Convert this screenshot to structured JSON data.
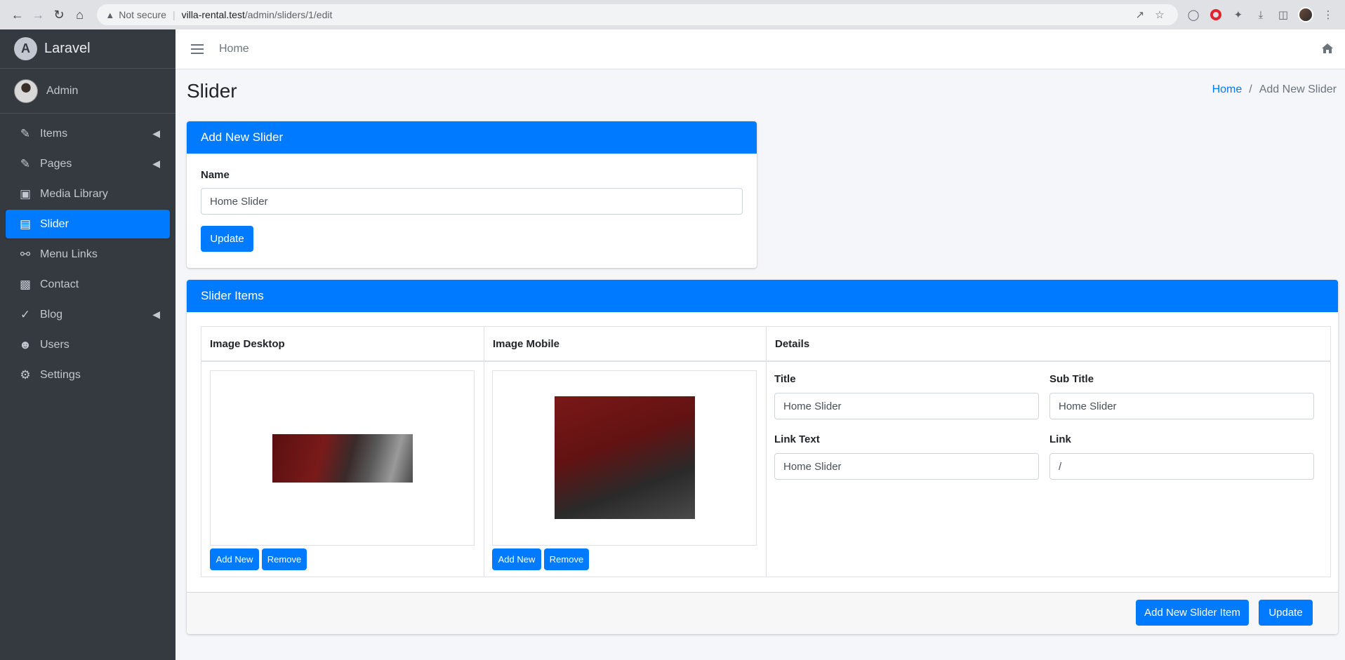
{
  "browser": {
    "security": "Not secure",
    "url_host": "villa-rental.test",
    "url_path": "/admin/sliders/1/edit"
  },
  "sidebar": {
    "brand": "Laravel",
    "user": "Admin",
    "items": [
      {
        "label": "Items",
        "icon": "edit-icon",
        "has_children": true
      },
      {
        "label": "Pages",
        "icon": "edit-icon",
        "has_children": true
      },
      {
        "label": "Media Library",
        "icon": "photo-video-icon",
        "has_children": false
      },
      {
        "label": "Slider",
        "icon": "images-icon",
        "has_children": false,
        "active": true
      },
      {
        "label": "Menu Links",
        "icon": "link-icon",
        "has_children": false
      },
      {
        "label": "Contact",
        "icon": "address-book-icon",
        "has_children": false
      },
      {
        "label": "Blog",
        "icon": "blog-icon",
        "has_children": true
      },
      {
        "label": "Users",
        "icon": "users-icon",
        "has_children": false
      },
      {
        "label": "Settings",
        "icon": "cogs-icon",
        "has_children": false
      }
    ]
  },
  "header": {
    "home_link": "Home"
  },
  "page": {
    "title": "Slider",
    "breadcrumb": [
      "Home",
      "Add New Slider"
    ]
  },
  "slider_form": {
    "header": "Add New Slider",
    "name_label": "Name",
    "name_value": "Home Slider",
    "update_label": "Update"
  },
  "slider_items": {
    "header": "Slider Items",
    "columns": [
      "Image Desktop",
      "Image Mobile",
      "Details"
    ],
    "add_new_label": "Add New",
    "remove_label": "Remove",
    "fields": {
      "title_label": "Title",
      "title_value": "Home Slider",
      "subtitle_label": "Sub Title",
      "subtitle_value": "Home Slider",
      "link_text_label": "Link Text",
      "link_text_value": "Home Slider",
      "link_label": "Link",
      "link_value": "/"
    },
    "add_item_label": "Add New Slider Item",
    "update_label": "Update"
  },
  "colors": {
    "primary": "#007bff",
    "sidebar_bg": "#343a40",
    "content_bg": "#f4f6f9"
  }
}
